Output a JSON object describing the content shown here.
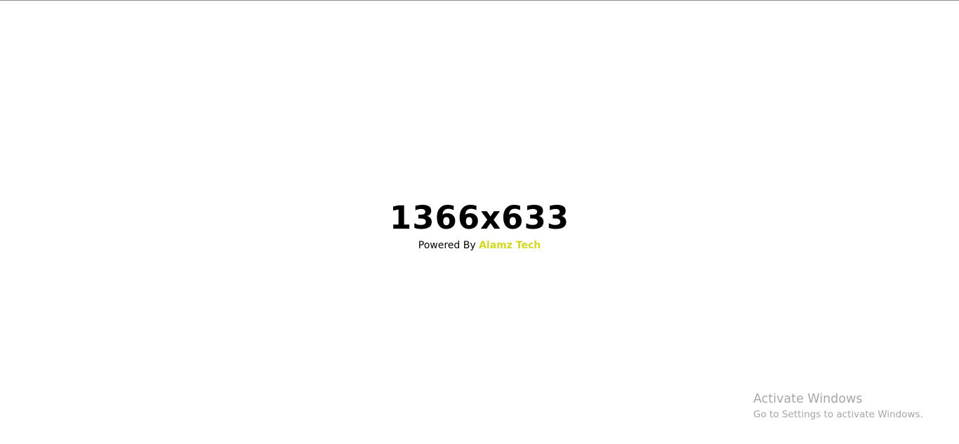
{
  "main": {
    "resolution_text": "1366x633",
    "powered_prefix": "Powered By",
    "brand_name": "Alamz Tech"
  },
  "watermark": {
    "title": "Activate Windows",
    "subtitle": "Go to Settings to activate Windows."
  },
  "colors": {
    "background": "#ffffff",
    "text": "#000000",
    "brand": "#d4d61f",
    "watermark": "#a6a6a6",
    "top_border": "#8a8a8a"
  }
}
